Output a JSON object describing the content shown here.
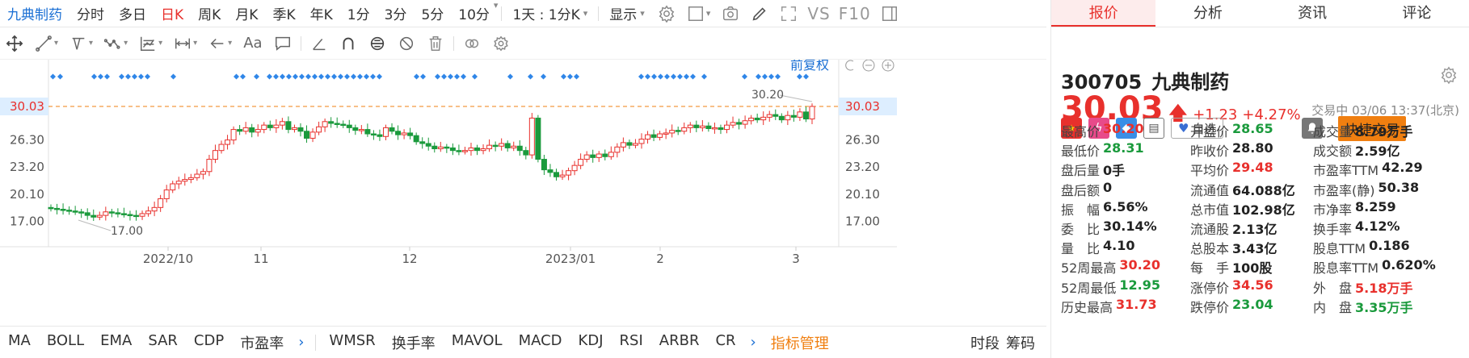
{
  "topbar": {
    "stock_name": "九典制药",
    "periods": [
      "分时",
      "多日",
      "日K",
      "周K",
      "月K",
      "季K",
      "年K",
      "1分",
      "3分",
      "5分",
      "10分"
    ],
    "active_period": "日K",
    "range": "1天 : 1分K",
    "display": "显示",
    "vs_label": "VS",
    "f10_label": "F10"
  },
  "drawbar": {
    "aa_label": "Aa"
  },
  "chart": {
    "adjust_label": "前复权",
    "price_tag": "30.03",
    "y_ticks": [
      "26.30",
      "23.20",
      "20.10",
      "17.00"
    ],
    "x_ticks": [
      "2022/10",
      "11",
      "12",
      "2023/01",
      "2",
      "3"
    ],
    "high_label": "30.20",
    "low_label": "17.00",
    "accent": "#1a6fd4",
    "up_color": "#e8302c",
    "down_color": "#1a9a3c"
  },
  "indicators": {
    "items": [
      "MA",
      "BOLL",
      "EMA",
      "SAR",
      "CDP",
      "市盈率"
    ],
    "items2": [
      "WMSR",
      "换手率",
      "MAVOL",
      "MACD",
      "KDJ",
      "RSI",
      "ARBR",
      "CR"
    ],
    "manage": "指标管理",
    "right": [
      "时段",
      "筹码"
    ]
  },
  "tabs": [
    "报价",
    "分析",
    "资讯",
    "评论"
  ],
  "active_tab": "报价",
  "stock": {
    "code": "300705",
    "name": "九典制药",
    "price": "30.03",
    "change": "+1.23",
    "change_pct": "+4.27%",
    "status": "交易中 03/06 13:37(北京)",
    "watch_label": "自选",
    "quick_trade": "快捷交易"
  },
  "quote": [
    [
      [
        "最高价",
        "30.20",
        "red"
      ],
      [
        "开盘价",
        "28.65",
        "green"
      ],
      [
        "成交量",
        "8.79万手",
        ""
      ]
    ],
    [
      [
        "最低价",
        "28.31",
        "green"
      ],
      [
        "昨收价",
        "28.80",
        ""
      ],
      [
        "成交额",
        "2.59亿",
        ""
      ]
    ],
    [
      [
        "盘后量",
        "0手",
        ""
      ],
      [
        "平均价",
        "29.48",
        "red"
      ],
      [
        "市盈率TTM",
        "42.29",
        ""
      ]
    ],
    [
      [
        "盘后额",
        "0",
        ""
      ],
      [
        "流通值",
        "64.088亿",
        ""
      ],
      [
        "市盈率(静)",
        "50.38",
        ""
      ]
    ],
    [
      [
        "振　幅",
        "6.56%",
        ""
      ],
      [
        "总市值",
        "102.98亿",
        ""
      ],
      [
        "市净率",
        "8.259",
        ""
      ]
    ],
    [
      [
        "委　比",
        "30.14%",
        ""
      ],
      [
        "流通股",
        "2.13亿",
        ""
      ],
      [
        "换手率",
        "4.12%",
        ""
      ]
    ],
    [
      [
        "量　比",
        "4.10",
        ""
      ],
      [
        "总股本",
        "3.43亿",
        ""
      ],
      [
        "股息TTM",
        "0.186",
        ""
      ]
    ],
    [
      [
        "52周最高",
        "30.20",
        "red"
      ],
      [
        "每　手",
        "100股",
        ""
      ],
      [
        "股息率TTM",
        "0.620%",
        ""
      ]
    ],
    [
      [
        "52周最低",
        "12.95",
        "green"
      ],
      [
        "涨停价",
        "34.56",
        "red"
      ],
      [
        "外　盘",
        "5.18万手",
        "red"
      ]
    ],
    [
      [
        "历史最高",
        "31.73",
        "red"
      ],
      [
        "跌停价",
        "23.04",
        "green"
      ],
      [
        "内　盘",
        "3.35万手",
        "green"
      ]
    ]
  ]
}
